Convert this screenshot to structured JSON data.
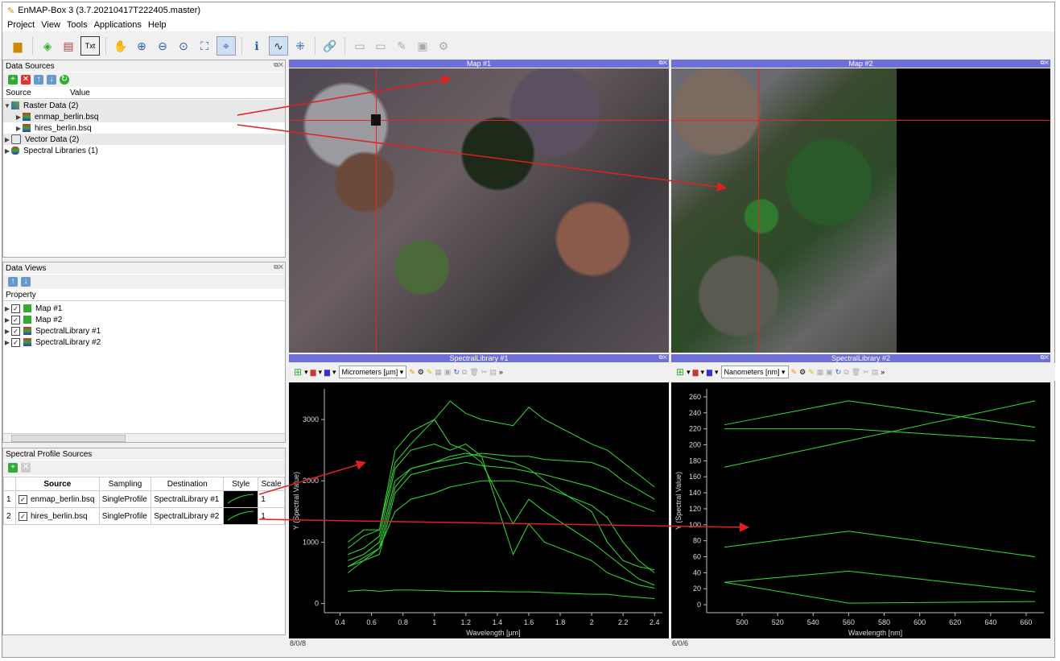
{
  "window": {
    "title": "EnMAP-Box 3 (3.7.20210417T222405.master)"
  },
  "menu": [
    "Project",
    "View",
    "Tools",
    "Applications",
    "Help"
  ],
  "toolbar": {
    "txt_label": "Txt"
  },
  "data_sources": {
    "title": "Data Sources",
    "columns": [
      "Source",
      "Value"
    ],
    "raster": "Raster Data (2)",
    "raster_items": [
      "enmap_berlin.bsq",
      "hires_berlin.bsq"
    ],
    "vector": "Vector Data (2)",
    "speclib": "Spectral Libraries (1)"
  },
  "data_views": {
    "title": "Data Views",
    "column": "Property",
    "items": [
      "Map #1",
      "Map #2",
      "SpectralLibrary #1",
      "SpectralLibrary #2"
    ]
  },
  "profile_sources": {
    "title": "Spectral Profile Sources",
    "columns": [
      "Source",
      "Sampling",
      "Destination",
      "Style",
      "Scale"
    ],
    "rows": [
      {
        "n": "1",
        "source": "enmap_berlin.bsq",
        "sampling": "SingleProfile",
        "dest": "SpectralLibrary #1",
        "scale": "1"
      },
      {
        "n": "2",
        "source": "hires_berlin.bsq",
        "sampling": "SingleProfile",
        "dest": "SpectralLibrary #2",
        "scale": "1"
      }
    ]
  },
  "maps": {
    "map1": "Map #1",
    "map2": "Map #2"
  },
  "speclib1": {
    "title": "SpectralLibrary #1",
    "units": "Micrometers [µm]",
    "ylabel": "Y (Spectral Value)",
    "xlabel": "Wavelength [µm]",
    "yticks": [
      "0",
      "1000",
      "2000",
      "3000"
    ],
    "xticks": [
      "0.4",
      "0.6",
      "0.8",
      "1",
      "1.2",
      "1.4",
      "1.6",
      "1.8",
      "2",
      "2.2",
      "2.4"
    ],
    "status": "8/0/8"
  },
  "speclib2": {
    "title": "SpectralLibrary #2",
    "units": "Nanometers [nm]",
    "ylabel": "Y (Spectral Value)",
    "xlabel": "Wavelength [nm]",
    "yticks": [
      "0",
      "20",
      "40",
      "60",
      "80",
      "100",
      "120",
      "140",
      "160",
      "180",
      "200",
      "220",
      "240",
      "260"
    ],
    "xticks": [
      "500",
      "520",
      "540",
      "560",
      "580",
      "600",
      "620",
      "640",
      "660"
    ],
    "status": "6/0/6"
  },
  "colors": {
    "accent": "#6f6fd8",
    "profile": "#33dd33",
    "arrow": "#e02020"
  },
  "chart_data": [
    {
      "type": "line",
      "xlabel": "Wavelength [µm]",
      "ylabel": "Y (Spectral Value)",
      "xlim": [
        0.3,
        2.45
      ],
      "ylim": [
        -150,
        3500
      ],
      "x": [
        0.45,
        0.55,
        0.65,
        0.75,
        0.85,
        1.0,
        1.1,
        1.2,
        1.3,
        1.5,
        1.6,
        1.7,
        2.0,
        2.1,
        2.2,
        2.3,
        2.4
      ],
      "series": [
        {
          "values": [
            200,
            220,
            200,
            220,
            220,
            210,
            200,
            200,
            200,
            190,
            190,
            180,
            150,
            150,
            120,
            100,
            80
          ]
        },
        {
          "values": [
            600,
            700,
            900,
            1500,
            1700,
            1800,
            1900,
            1950,
            2000,
            2000,
            1950,
            1900,
            1600,
            1400,
            1000,
            700,
            500
          ]
        },
        {
          "values": [
            700,
            800,
            1000,
            2000,
            2200,
            2300,
            2400,
            2450,
            2400,
            2300,
            2200,
            2000,
            1500,
            1000,
            700,
            600,
            550
          ]
        },
        {
          "values": [
            800,
            900,
            1100,
            2200,
            2500,
            2600,
            2500,
            2600,
            2400,
            800,
            1300,
            1000,
            700,
            500,
            400,
            300,
            250
          ]
        },
        {
          "values": [
            1000,
            1200,
            1200,
            2300,
            2600,
            3000,
            3300,
            3100,
            3000,
            2900,
            3200,
            3000,
            2600,
            2500,
            2300,
            2100,
            1900
          ]
        },
        {
          "values": [
            900,
            1100,
            1200,
            2500,
            2800,
            3000,
            2600,
            2500,
            2300,
            1300,
            1700,
            1500,
            1000,
            800,
            600,
            400,
            300
          ]
        },
        {
          "values": [
            500,
            700,
            800,
            1800,
            2100,
            2200,
            2250,
            2300,
            2250,
            2200,
            2150,
            2100,
            1900,
            1800,
            1700,
            1600,
            1500
          ]
        },
        {
          "values": [
            600,
            750,
            900,
            1900,
            2200,
            2300,
            2350,
            2400,
            2450,
            2400,
            2400,
            2350,
            2300,
            2200,
            2000,
            1850,
            1700
          ]
        }
      ]
    },
    {
      "type": "line",
      "xlabel": "Wavelength [nm]",
      "ylabel": "Y (Spectral Value)",
      "xlim": [
        480,
        670
      ],
      "ylim": [
        -10,
        270
      ],
      "x": [
        490,
        560,
        665
      ],
      "series": [
        {
          "values": [
            225,
            255,
            222
          ]
        },
        {
          "values": [
            172,
            205,
            255
          ]
        },
        {
          "values": [
            220,
            220,
            205
          ]
        },
        {
          "values": [
            72,
            92,
            60
          ]
        },
        {
          "values": [
            28,
            42,
            16
          ]
        },
        {
          "values": [
            28,
            2,
            4
          ]
        }
      ]
    }
  ]
}
